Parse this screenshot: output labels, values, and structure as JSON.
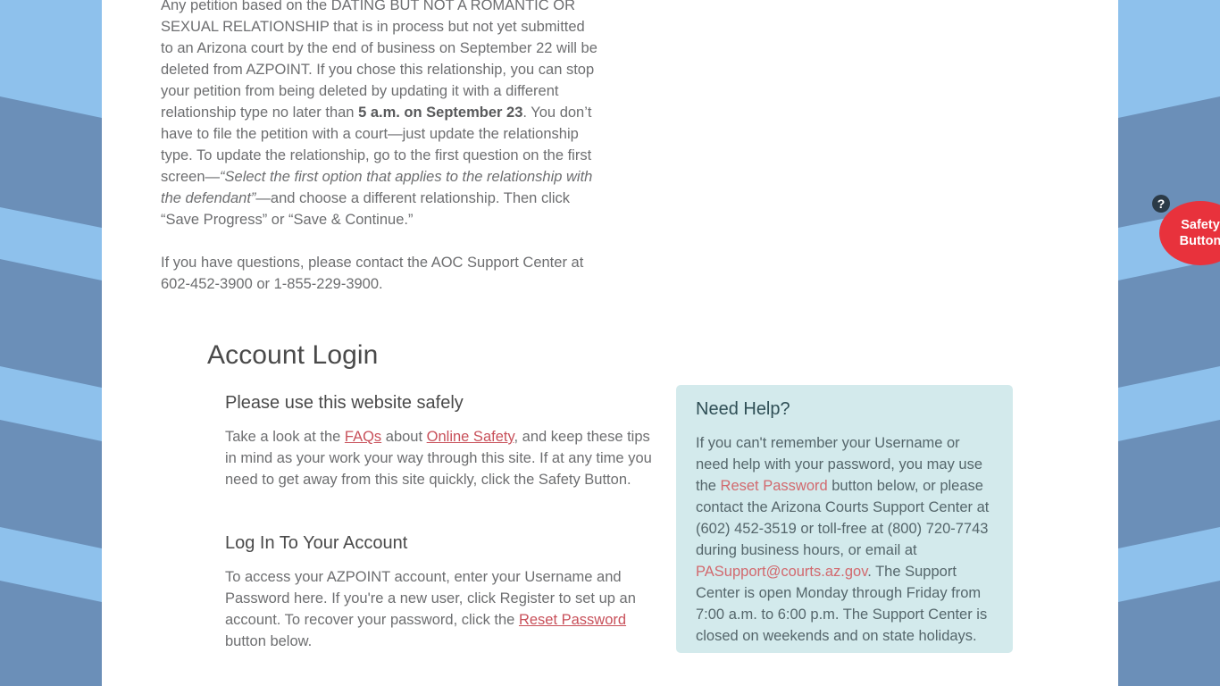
{
  "colors": {
    "bg_light_stripe": "#8ec1ec",
    "bg_dark_stripe": "#6b8fb8",
    "sheet": "#ffffff",
    "link_red": "#c8505a",
    "help_panel_bg": "#d3eaec",
    "safety_button_red": "#e8323c",
    "help_icon_navy": "#2b3a46"
  },
  "notice": {
    "paragraph1_part1": "Any petition based on the DATING BUT NOT A ROMANTIC OR SEXUAL RELATIONSHIP that is in process but not yet submitted to an Arizona court by the end of business on September 22 will be deleted from AZPOINT. If you chose this relationship, you can stop your petition from being deleted by updating it with a different relationship type no later than ",
    "paragraph1_bold": "5 a.m. on September 23",
    "paragraph1_part2": ". You don’t have to file the petition with a court—just update the relationship type. To update the relationship, go to the first question on the first screen—",
    "paragraph1_italic": "“Select the first option that applies to the relationship with the defendant”",
    "paragraph1_part3": "—and choose a different relationship. Then click “Save Progress” or “Save & Continue.”",
    "paragraph2": "If you have questions, please contact the AOC Support Center at 602-452-3900 or 1-855-229-3900."
  },
  "page_title": "Account Login",
  "left_column": {
    "safety_heading": "Please use this website safely",
    "safety_text_part1": "Take a look at the ",
    "safety_link_faqs": "FAQs",
    "safety_text_part2": " about ",
    "safety_link_online_safety": "Online Safety",
    "safety_text_part3": ", and keep these tips in mind as your work your way through this site. If at any time you need to get away from this site quickly, click the Safety Button.",
    "login_heading": "Log In To Your Account",
    "login_text_part1": "To access your AZPOINT account, enter your Username and Password here. If you're a new user, click Register to set up an account. To recover your password, click the ",
    "login_link_reset_password": "Reset Password",
    "login_text_part2": " button below."
  },
  "help_panel": {
    "heading": "Need Help?",
    "text_part1": "If you can't remember your Username or need help with your password, you may use the ",
    "link_reset_password": "Reset Password",
    "text_part2": " button below, or please contact the Arizona Courts Support Center at (602) 452-3519 or toll-free at (800) 720-7743 during business hours, or email at ",
    "link_email": "PASupport@courts.az.gov",
    "text_part3": ". The Support Center is open Monday through Friday from 7:00 a.m. to 6:00 p.m. The Support Center is closed on weekends and on state holidays."
  },
  "safety": {
    "help_icon_glyph": "?",
    "button_line1": "Safety",
    "button_line2": "Button"
  }
}
